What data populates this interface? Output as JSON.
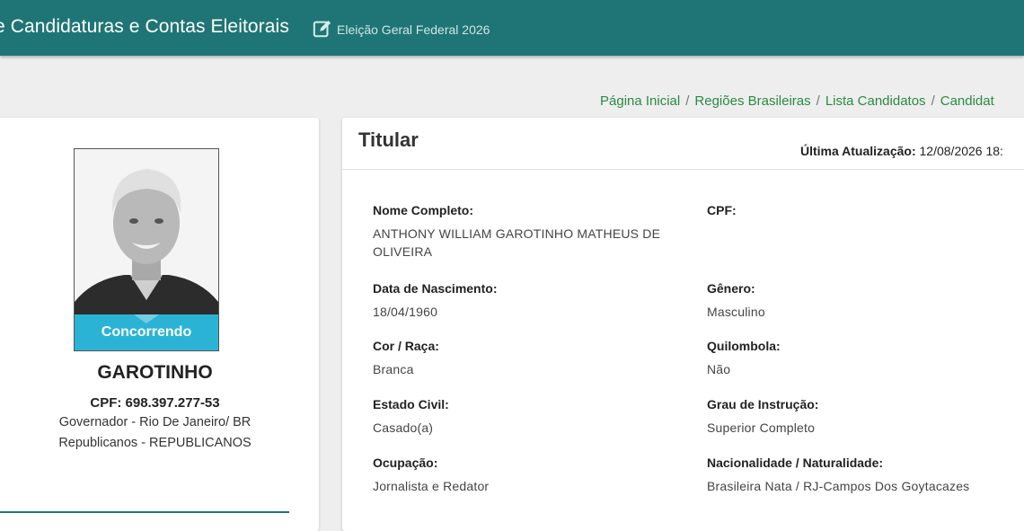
{
  "header": {
    "app_title": "e Candidaturas e Contas Eleitorais",
    "election_name": "Eleição Geral Federal 2026",
    "accent_color": "#1f7575"
  },
  "breadcrumb": {
    "items": [
      "Página Inicial",
      "Regiões Brasileiras",
      "Lista Candidatos",
      "Candidat"
    ],
    "separator": "/"
  },
  "candidate": {
    "status": "Concorrendo",
    "name": "GAROTINHO",
    "cpf": "CPF: 698.397.277-53",
    "office": "Governador - Rio De Janeiro/ BR",
    "party": "Republicanos - REPUBLICANOS"
  },
  "details": {
    "title": "Titular",
    "last_update_label": "Última Atualização:",
    "last_update_value": "12/08/2026 18:",
    "fields": [
      {
        "label": "Nome Completo:",
        "value": "ANTHONY WILLIAM GAROTINHO MATHEUS DE OLIVEIRA"
      },
      {
        "label": "CPF:",
        "value": ""
      },
      {
        "label": "Data de Nascimento:",
        "value": "18/04/1960"
      },
      {
        "label": "Gênero:",
        "value": "Masculino"
      },
      {
        "label": "Cor / Raça:",
        "value": "Branca"
      },
      {
        "label": "Quilombola:",
        "value": "Não"
      },
      {
        "label": "Estado Civil:",
        "value": "Casado(a)"
      },
      {
        "label": "Grau de Instrução:",
        "value": "Superior Completo"
      },
      {
        "label": "Ocupação:",
        "value": "Jornalista e Redator"
      },
      {
        "label": "Nacionalidade / Naturalidade:",
        "value": "Brasileira Nata / RJ-Campos Dos Goytacazes"
      }
    ]
  }
}
